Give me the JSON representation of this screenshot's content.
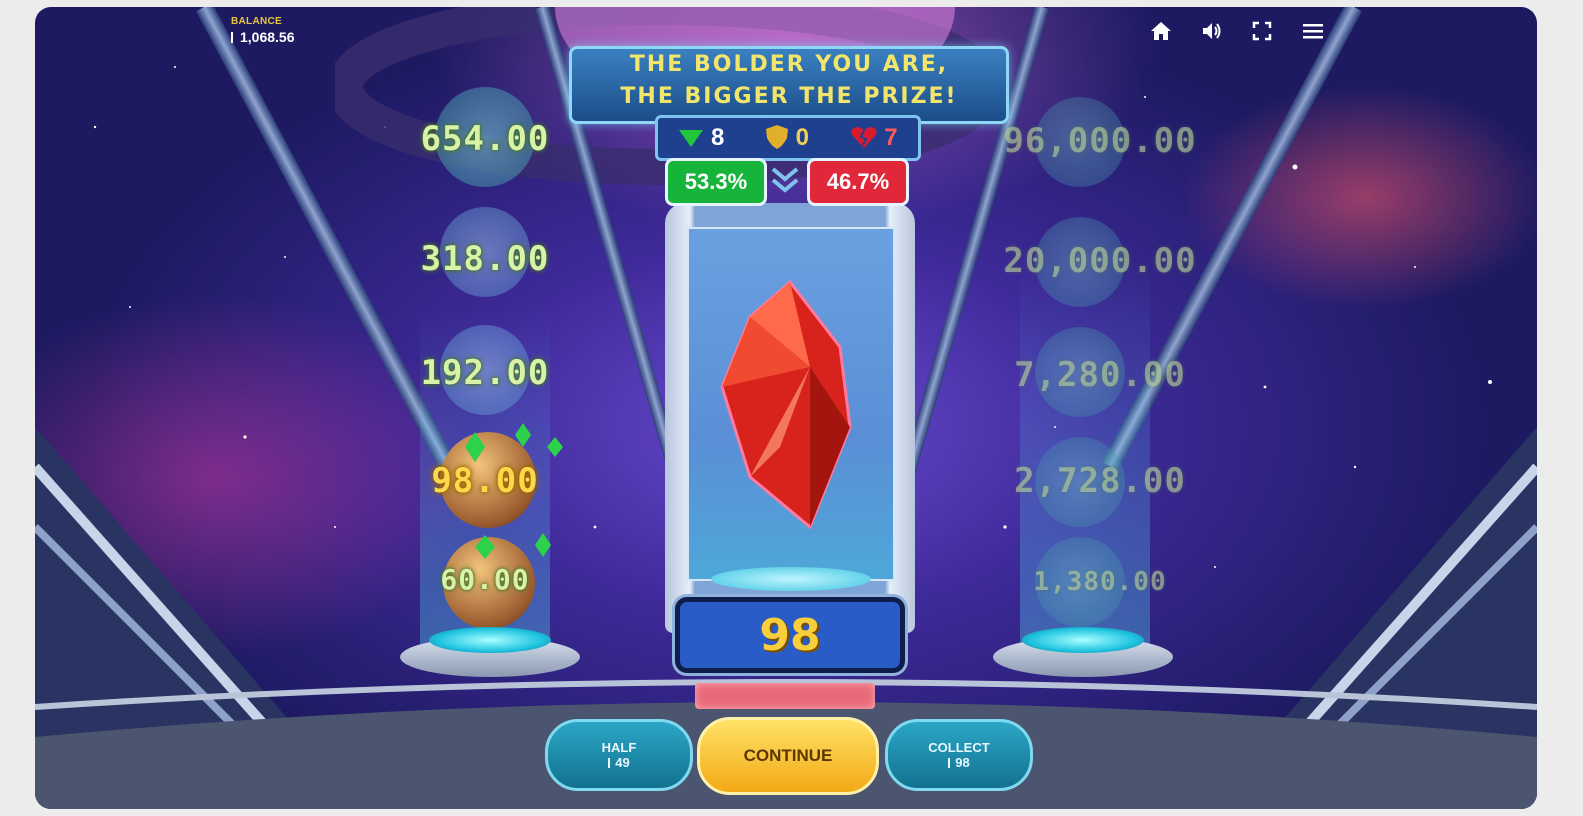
{
  "header": {
    "balance_label": "BALANCE",
    "balance_value": "1,068.56",
    "icons": [
      "home-icon",
      "sound-icon",
      "fullscreen-icon",
      "menu-icon"
    ]
  },
  "banner": {
    "line1": "THE BOLDER YOU ARE,",
    "line2": "THE BIGGER THE PRIZE!"
  },
  "counters": {
    "green_count": "8",
    "shield_count": "0",
    "red_count": "7",
    "green_pct": "53.3%",
    "red_pct": "46.7%"
  },
  "left_ladder": [
    "654.00",
    "318.00",
    "192.00",
    "98.00",
    "60.00"
  ],
  "right_ladder": [
    "96,000.00",
    "20,000.00",
    "7,280.00",
    "2,728.00",
    "1,380.00"
  ],
  "current_value": "98",
  "buttons": {
    "half_label": "HALF",
    "half_value": "49",
    "continue_label": "CONTINUE",
    "collect_label": "COLLECT",
    "collect_value": "98"
  },
  "colors": {
    "accent_gold": "#f8cf3a",
    "green": "#1fbf3a",
    "red": "#e0283a",
    "cyan": "#2ba6c6"
  }
}
